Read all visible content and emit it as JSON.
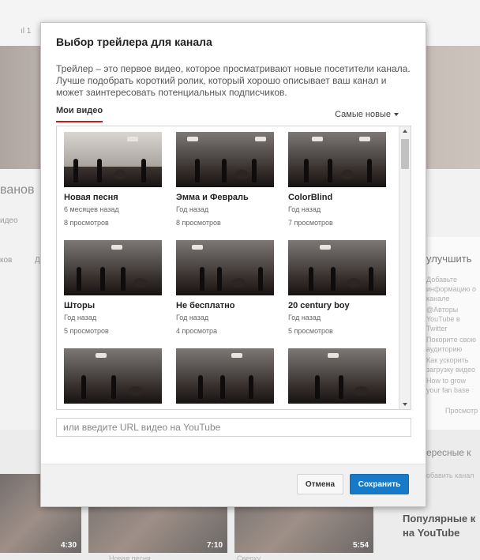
{
  "background": {
    "header_hint": "ıl 1",
    "name_fragment": "ванов",
    "tab_fragment": "идео",
    "nav_fragment": "ков",
    "nav_fragment2": "Д",
    "improve_title": "улучшить",
    "improve_items": [
      "Добавьте информацию о канале",
      "@Авторы YouTube в Twitter",
      "Покорите свою аудиторию",
      "Как ускорить загрузку видео",
      "How to grow your fan base"
    ],
    "more_link": "Просмотр",
    "interesting_title": "ересные к",
    "interesting_sub": "обавить канал",
    "popular_title": "Популярные к на YouTube",
    "durations": [
      "4:30",
      "7:10",
      "5:54"
    ],
    "bottom_fragments": [
      "Новая песня",
      "Сверху"
    ]
  },
  "dialog": {
    "title": "Выбор трейлера для канала",
    "description": "Трейлер – это первое видео, которое просматривают новые посетители канала. Лучше подобрать короткий ролик, который хорошо описывает ваш канал и может заинтересовать потенциальных подписчиков.",
    "tab_label": "Мои видео",
    "sort_label": "Самые новые",
    "videos": [
      {
        "title": "Новая песня",
        "age": "6 месяцев назад",
        "views": "8 просмотров"
      },
      {
        "title": "Эмма и Февраль",
        "age": "Год назад",
        "views": "8 просмотров"
      },
      {
        "title": "ColorBlind",
        "age": "Год назад",
        "views": "7 просмотров"
      },
      {
        "title": "Шторы",
        "age": "Год назад",
        "views": "5 просмотров"
      },
      {
        "title": "Не бесплатно",
        "age": "Год назад",
        "views": "4 просмотра"
      },
      {
        "title": "20 century boy",
        "age": "Год назад",
        "views": "5 просмотров"
      },
      {
        "title": "",
        "age": "",
        "views": ""
      },
      {
        "title": "",
        "age": "",
        "views": ""
      },
      {
        "title": "",
        "age": "",
        "views": ""
      }
    ],
    "url_placeholder": "или введите URL видео на YouTube",
    "cancel_label": "Отмена",
    "save_label": "Сохранить"
  },
  "colors": {
    "accent_red": "#cc181e",
    "save_blue": "#167ac6"
  }
}
